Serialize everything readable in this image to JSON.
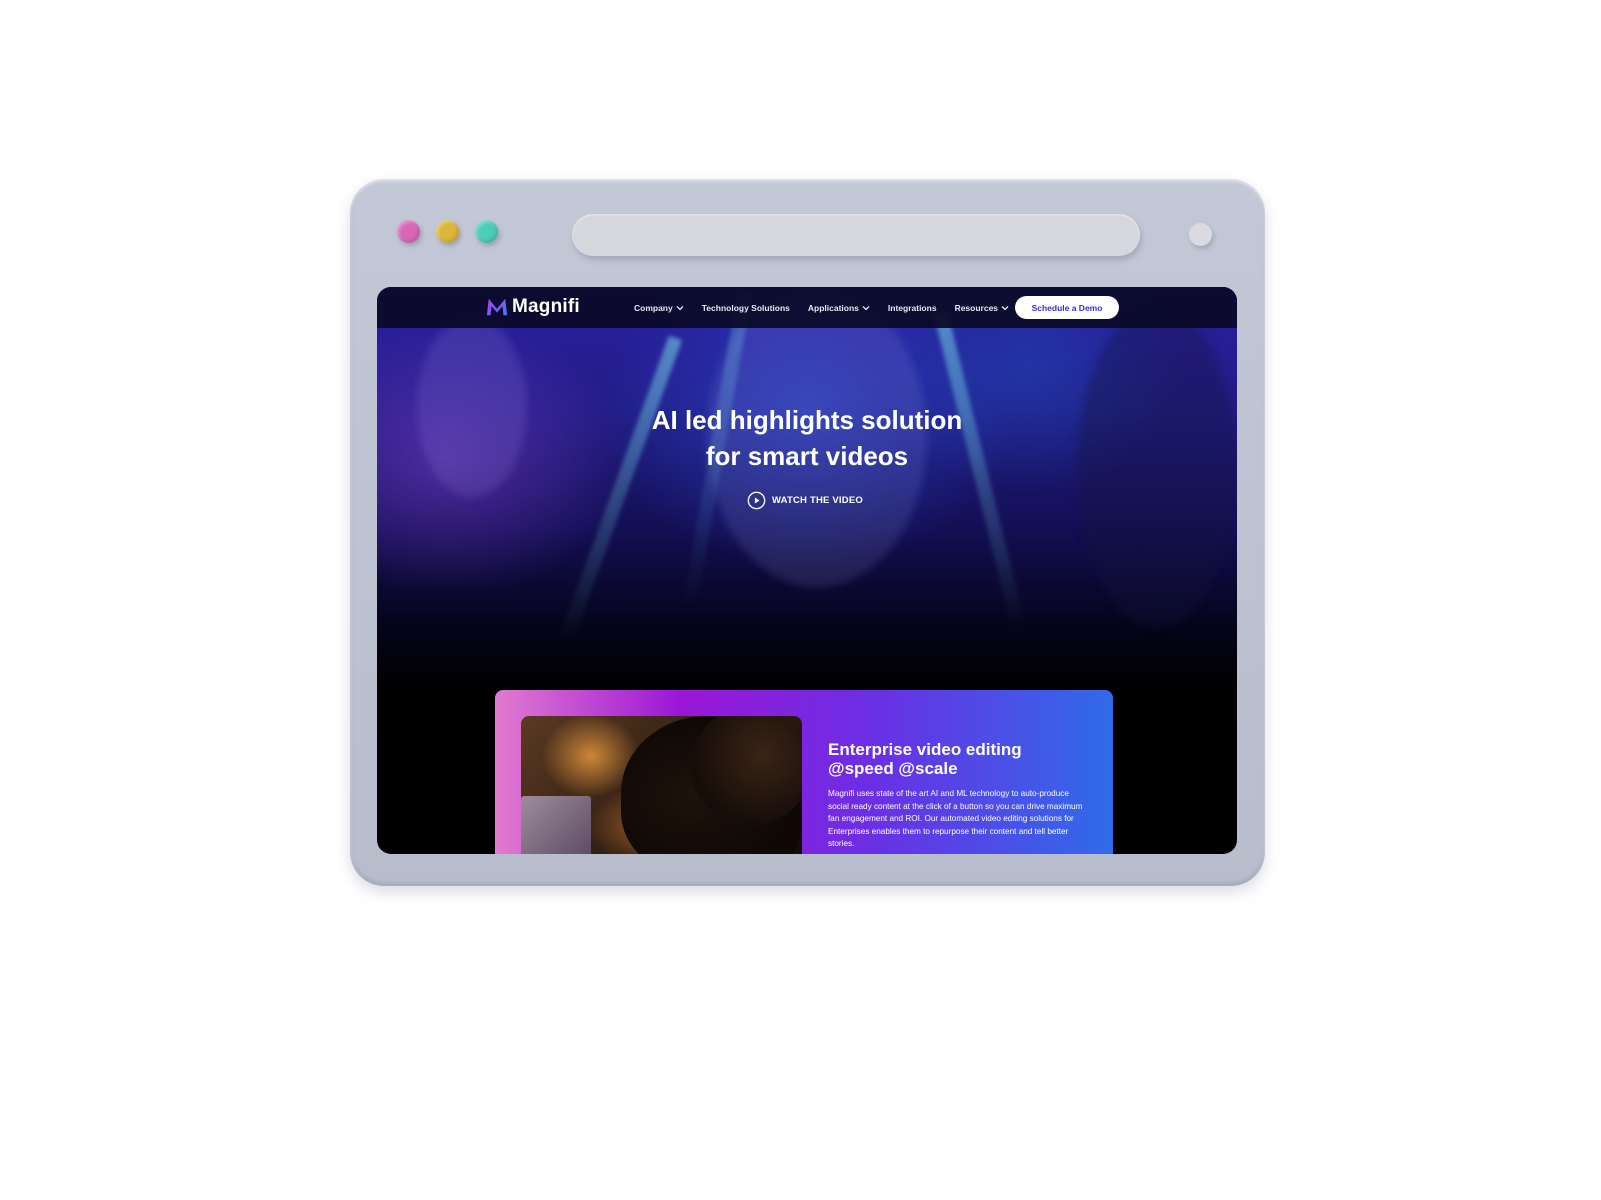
{
  "browser": {
    "controls": [
      "close",
      "minimize",
      "maximize"
    ],
    "colors": {
      "close": "#d768b9",
      "minimize": "#dbb63b",
      "maximize": "#4ccdb9"
    }
  },
  "nav": {
    "brand": "Magnifi",
    "items": [
      {
        "label": "Company",
        "has_dropdown": true
      },
      {
        "label": "Technology Solutions",
        "has_dropdown": false
      },
      {
        "label": "Applications",
        "has_dropdown": true
      },
      {
        "label": "Integrations",
        "has_dropdown": false
      },
      {
        "label": "Resources",
        "has_dropdown": true
      }
    ],
    "cta_label": "Schedule a Demo"
  },
  "hero": {
    "title_line1": "AI led highlights solution",
    "title_line2": "for smart videos",
    "watch_label": "WATCH THE VIDEO"
  },
  "card": {
    "title_line1": "Enterprise video editing",
    "title_line2": "@speed @scale",
    "body": "Magnifi uses state of the art AI and ML technology to auto-produce social ready content at the click of a button so you can drive maximum fan engagement and ROI. Our automated video editing solutions for Enterprises enables them to repurpose their content and tell better stories."
  },
  "colors": {
    "accent": "#3a2bd8",
    "nav_bg": "#0a0a26",
    "card_gradient": [
      "#e27bcf",
      "#9b16d6",
      "#6c2ee4",
      "#2f6be9"
    ]
  }
}
